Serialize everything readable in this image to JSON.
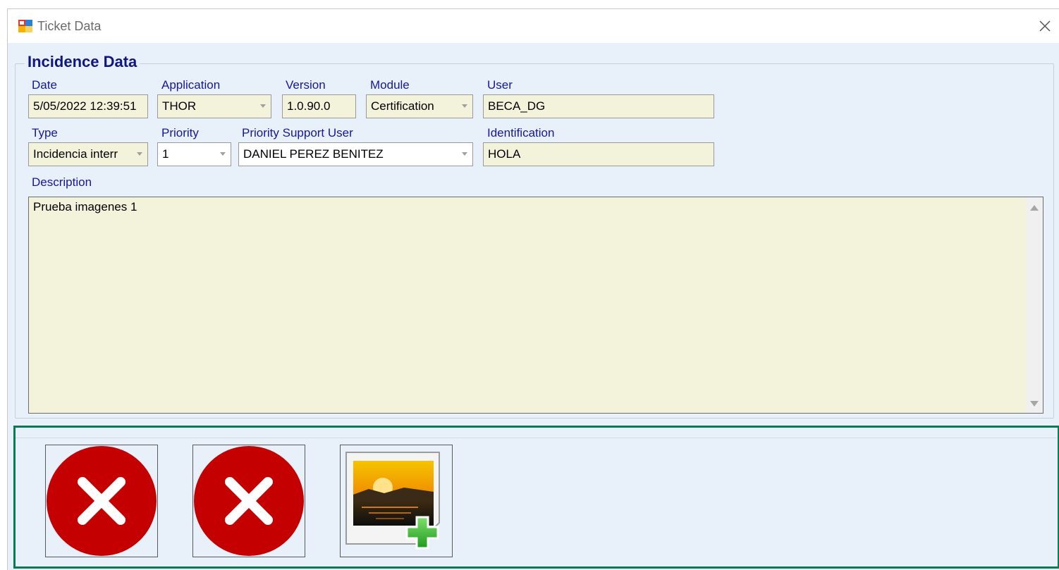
{
  "window": {
    "title": "Ticket Data"
  },
  "group": {
    "title": "Incidence Data"
  },
  "fields": {
    "date": {
      "label": "Date",
      "value": "5/05/2022 12:39:51"
    },
    "application": {
      "label": "Application",
      "value": "THOR"
    },
    "version": {
      "label": "Version",
      "value": "1.0.90.0"
    },
    "module": {
      "label": "Module",
      "value": "Certification"
    },
    "user": {
      "label": "User",
      "value": "BECA_DG"
    },
    "type": {
      "label": "Type",
      "value": "Incidencia interr"
    },
    "priority": {
      "label": "Priority",
      "value": "1"
    },
    "priority_support_user": {
      "label": "Priority Support User",
      "value": "DANIEL PEREZ BENITEZ"
    },
    "identification": {
      "label": "Identification",
      "value": "HOLA"
    },
    "description": {
      "label": "Description",
      "value": "Prueba imagenes 1"
    }
  },
  "images": [
    {
      "icon": "error-x-icon"
    },
    {
      "icon": "error-x-icon"
    },
    {
      "icon": "add-image-icon"
    }
  ],
  "colors": {
    "label": "#15189a",
    "group_title": "#10177f",
    "field_bg": "#f3f3dc",
    "window_bg": "#e8f0fa",
    "panel_border": "#0a7a52",
    "error_red": "#c40000"
  }
}
